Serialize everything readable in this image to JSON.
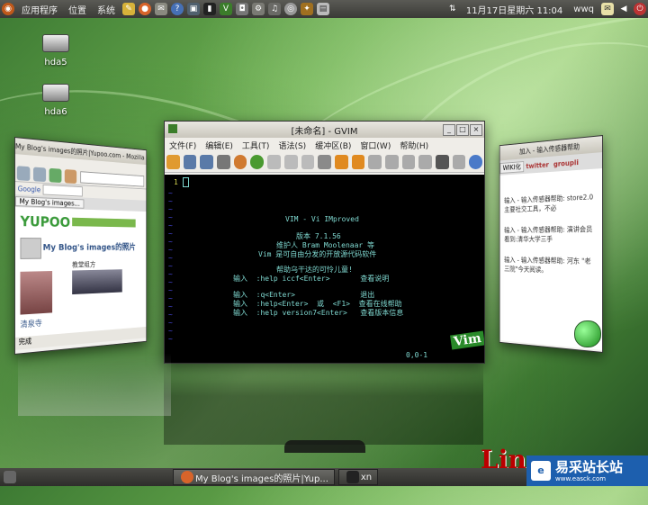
{
  "top_panel": {
    "menus": [
      "应用程序",
      "位置",
      "系统"
    ],
    "datetime": "11月17日星期六 11:04",
    "user": "wwq"
  },
  "desktop": {
    "icons": [
      "hda5",
      "hda6"
    ]
  },
  "gvim": {
    "title": "[未命名] - GVIM",
    "menu": [
      "文件(F)",
      "编辑(E)",
      "工具(T)",
      "语法(S)",
      "缓冲区(B)",
      "窗口(W)",
      "帮助(H)"
    ],
    "line_number": "1",
    "intro": [
      "VIM - Vi IMproved",
      "版本 7.1.56",
      "维护人 Bram Moolenaar 等",
      "Vim 是可自由分发的开放源代码软件",
      "帮助乌干达的可怜儿童!",
      "输入  :help iccf<Enter>       查看说明",
      "输入  :q<Enter>               退出",
      "输入  :help<Enter>  或  <F1>  查看在线帮助",
      "输入  :help version7<Enter>   查看版本信息"
    ],
    "status": "0,0-1",
    "logo": "Vim"
  },
  "firefox": {
    "title": "My Blog's images的照片|Yupoo.com - Mozilla Firefox",
    "logo": "YUPOO",
    "blog_title": "My Blog's images的照片",
    "tab": "My Blog's images...",
    "search": "Google",
    "album": "教堂组方",
    "caption": "清泉寺",
    "status": "完成"
  },
  "right_window": {
    "title": "加入 - 输入传感器帮助",
    "tabs": [
      "WIKI化",
      "twitter",
      "groupli"
    ],
    "lines": [
      "输入 - 输入传感器帮助: store2.0 主要社交工具，不必",
      "输入 - 输入传感器帮助: 演讲会员看到:清华大学三手",
      "输入 - 输入传感器帮助: 河东 \"老三院\"今天阅读。"
    ]
  },
  "taskbar": {
    "items": [
      "My Blog's images的照片|Yup...",
      "xn"
    ]
  },
  "watermark": {
    "brand": "易采站长站",
    "url": "www.easck.com",
    "lin": "Lin"
  }
}
